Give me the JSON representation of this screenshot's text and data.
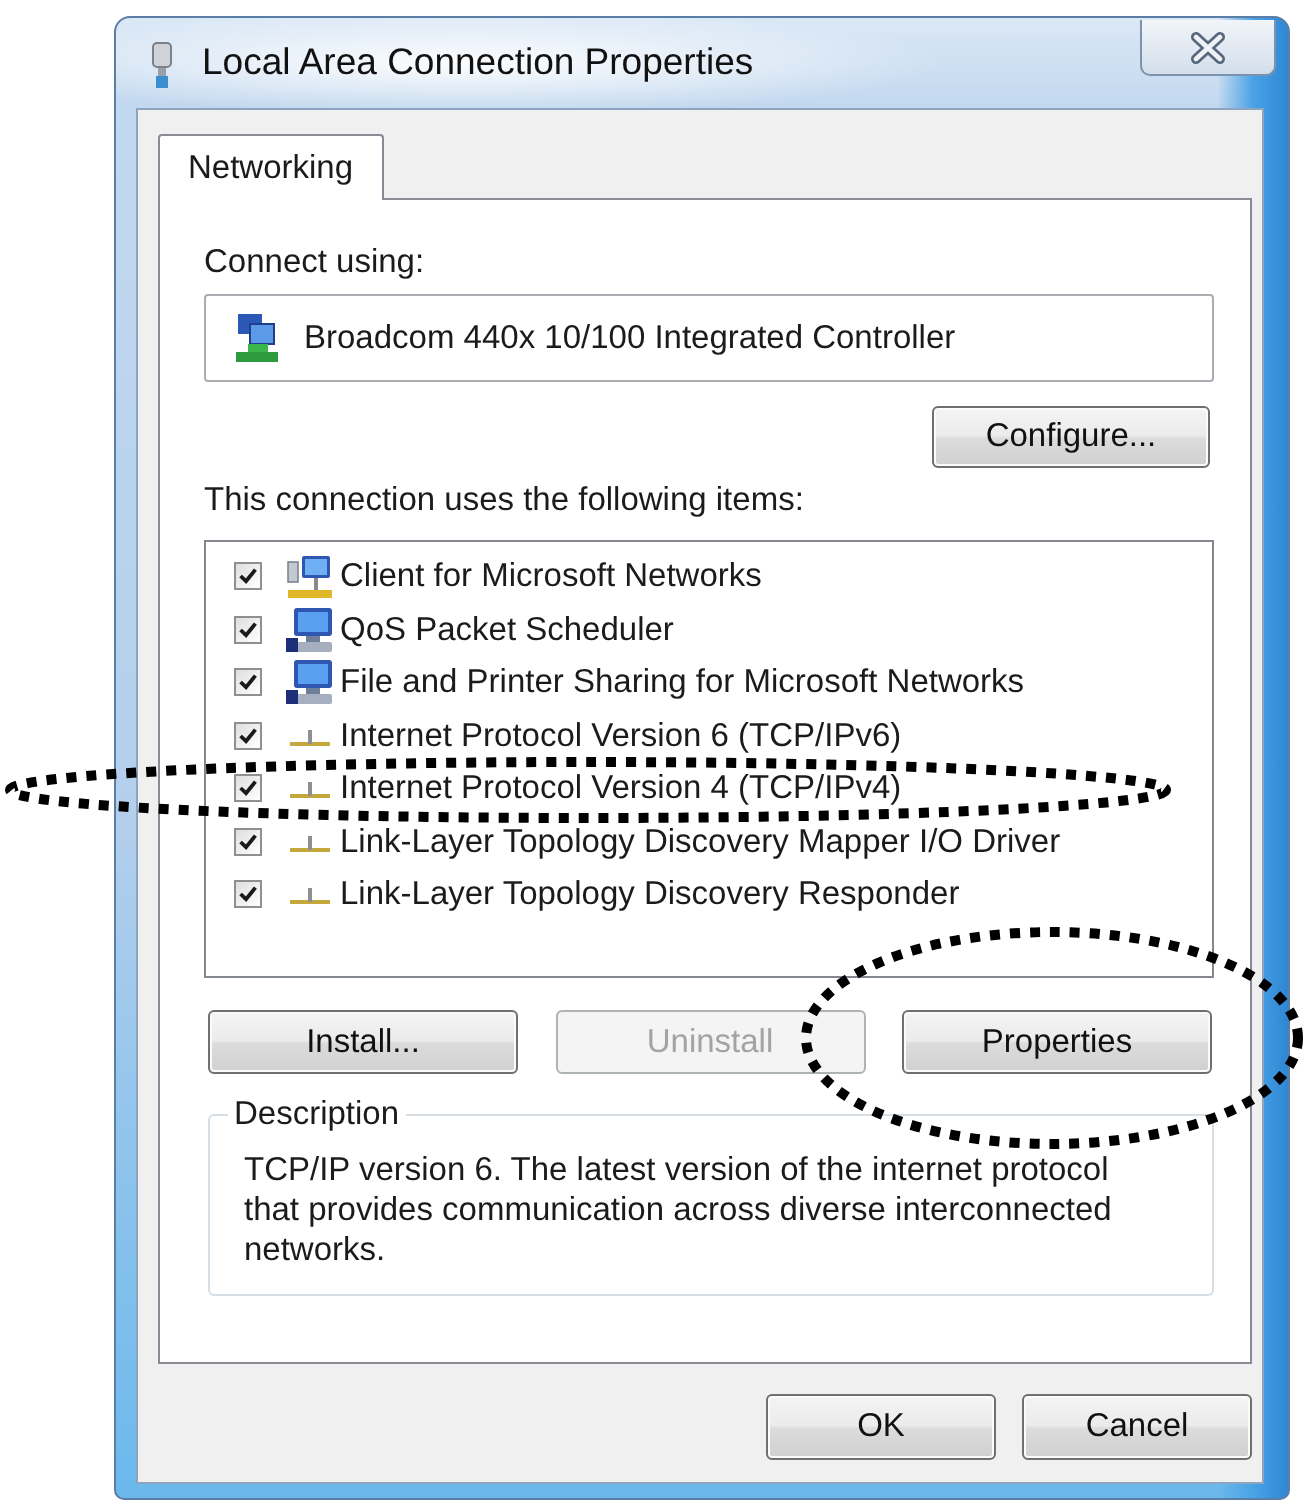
{
  "window": {
    "title": "Local Area Connection Properties"
  },
  "tabs": [
    {
      "label": "Networking",
      "selected": true
    }
  ],
  "connection": {
    "label": "Connect using:",
    "adapter": "Broadcom 440x 10/100 Integrated Controller",
    "configure_button": "Configure..."
  },
  "components": {
    "label": "This connection uses the following items:",
    "items": [
      {
        "kind": "client",
        "label": "Client for Microsoft Networks",
        "checked": true,
        "selected": false,
        "circled": false
      },
      {
        "kind": "service",
        "label": "QoS Packet Scheduler",
        "checked": true,
        "selected": false,
        "circled": false
      },
      {
        "kind": "service",
        "label": "File and Printer Sharing for Microsoft Networks",
        "checked": true,
        "selected": false,
        "circled": false
      },
      {
        "kind": "protocol",
        "label": "Internet Protocol Version 6 (TCP/IPv6)",
        "checked": true,
        "selected": false,
        "circled": false
      },
      {
        "kind": "protocol",
        "label": "Internet Protocol Version 4 (TCP/IPv4)",
        "checked": true,
        "selected": false,
        "circled": true
      },
      {
        "kind": "protocol",
        "label": "Link-Layer Topology Discovery Mapper I/O Driver",
        "checked": true,
        "selected": false,
        "circled": false
      },
      {
        "kind": "protocol",
        "label": "Link-Layer Topology Discovery Responder",
        "checked": true,
        "selected": false,
        "circled": false
      }
    ]
  },
  "component_buttons": [
    {
      "label": "Install...",
      "disabled": false,
      "circled": false
    },
    {
      "label": "Uninstall",
      "disabled": true,
      "circled": false
    },
    {
      "label": "Properties",
      "disabled": false,
      "circled": true
    }
  ],
  "description": {
    "title": "Description",
    "text": "TCP/IP version 6. The latest version of the internet protocol that provides communication across diverse interconnected networks."
  },
  "dialog_buttons": [
    "OK",
    "Cancel"
  ]
}
